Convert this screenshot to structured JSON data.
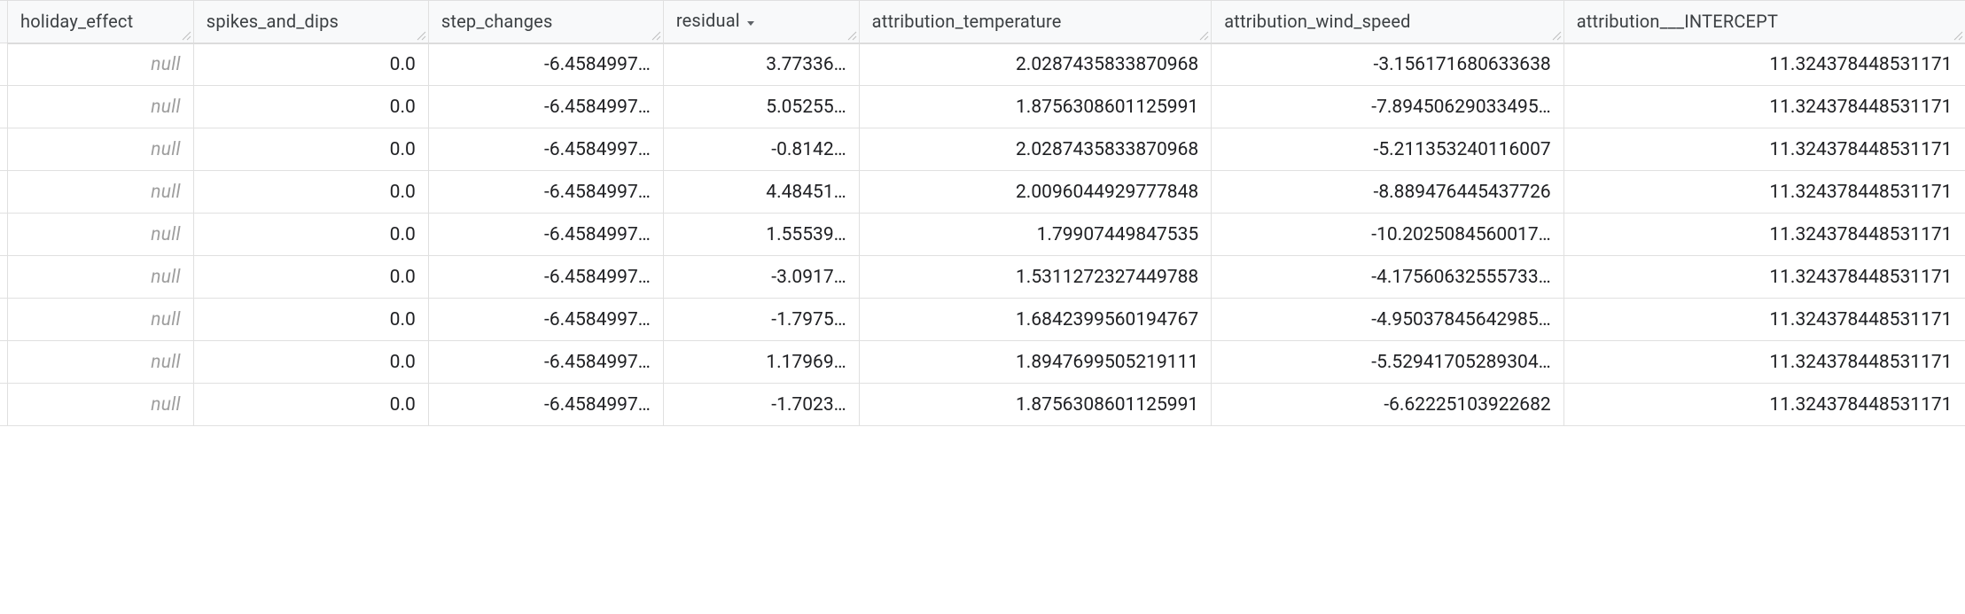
{
  "table": {
    "columns": [
      {
        "key": "holiday_effect",
        "label": "holiday_effect",
        "sorted": false
      },
      {
        "key": "spikes_and_dips",
        "label": "spikes_and_dips",
        "sorted": false
      },
      {
        "key": "step_changes",
        "label": "step_changes",
        "sorted": false
      },
      {
        "key": "residual",
        "label": "residual",
        "sorted": true
      },
      {
        "key": "attribution_temperature",
        "label": "attribution_temperature",
        "sorted": false
      },
      {
        "key": "attribution_wind_speed",
        "label": "attribution_wind_speed",
        "sorted": false
      },
      {
        "key": "attribution___INTERCEPT",
        "label": "attribution___INTERCEPT",
        "sorted": false
      }
    ],
    "null_label": "null",
    "rows": [
      {
        "holiday_effect": null,
        "spikes_and_dips": "0.0",
        "step_changes": "-6.4584997…",
        "residual": "3.77336…",
        "attribution_temperature": "2.0287435833870968",
        "attribution_wind_speed": "-3.156171680633638",
        "attribution___INTERCEPT": "11.324378448531171"
      },
      {
        "holiday_effect": null,
        "spikes_and_dips": "0.0",
        "step_changes": "-6.4584997…",
        "residual": "5.05255…",
        "attribution_temperature": "1.8756308601125991",
        "attribution_wind_speed": "-7.89450629033495…",
        "attribution___INTERCEPT": "11.324378448531171"
      },
      {
        "holiday_effect": null,
        "spikes_and_dips": "0.0",
        "step_changes": "-6.4584997…",
        "residual": "-0.8142…",
        "attribution_temperature": "2.0287435833870968",
        "attribution_wind_speed": "-5.211353240116007",
        "attribution___INTERCEPT": "11.324378448531171"
      },
      {
        "holiday_effect": null,
        "spikes_and_dips": "0.0",
        "step_changes": "-6.4584997…",
        "residual": "4.48451…",
        "attribution_temperature": "2.0096044929777848",
        "attribution_wind_speed": "-8.889476445437726",
        "attribution___INTERCEPT": "11.324378448531171"
      },
      {
        "holiday_effect": null,
        "spikes_and_dips": "0.0",
        "step_changes": "-6.4584997…",
        "residual": "1.55539…",
        "attribution_temperature": "1.79907449847535",
        "attribution_wind_speed": "-10.2025084560017…",
        "attribution___INTERCEPT": "11.324378448531171"
      },
      {
        "holiday_effect": null,
        "spikes_and_dips": "0.0",
        "step_changes": "-6.4584997…",
        "residual": "-3.0917…",
        "attribution_temperature": "1.5311272327449788",
        "attribution_wind_speed": "-4.17560632555733…",
        "attribution___INTERCEPT": "11.324378448531171"
      },
      {
        "holiday_effect": null,
        "spikes_and_dips": "0.0",
        "step_changes": "-6.4584997…",
        "residual": "-1.7975…",
        "attribution_temperature": "1.6842399560194767",
        "attribution_wind_speed": "-4.95037845642985…",
        "attribution___INTERCEPT": "11.324378448531171"
      },
      {
        "holiday_effect": null,
        "spikes_and_dips": "0.0",
        "step_changes": "-6.4584997…",
        "residual": "1.17969…",
        "attribution_temperature": "1.8947699505219111",
        "attribution_wind_speed": "-5.52941705289304…",
        "attribution___INTERCEPT": "11.324378448531171"
      },
      {
        "holiday_effect": null,
        "spikes_and_dips": "0.0",
        "step_changes": "-6.4584997…",
        "residual": "-1.7023…",
        "attribution_temperature": "1.8756308601125991",
        "attribution_wind_speed": "-6.62225103922682",
        "attribution___INTERCEPT": "11.324378448531171"
      }
    ]
  },
  "icons": {
    "sort_desc": "▼"
  }
}
